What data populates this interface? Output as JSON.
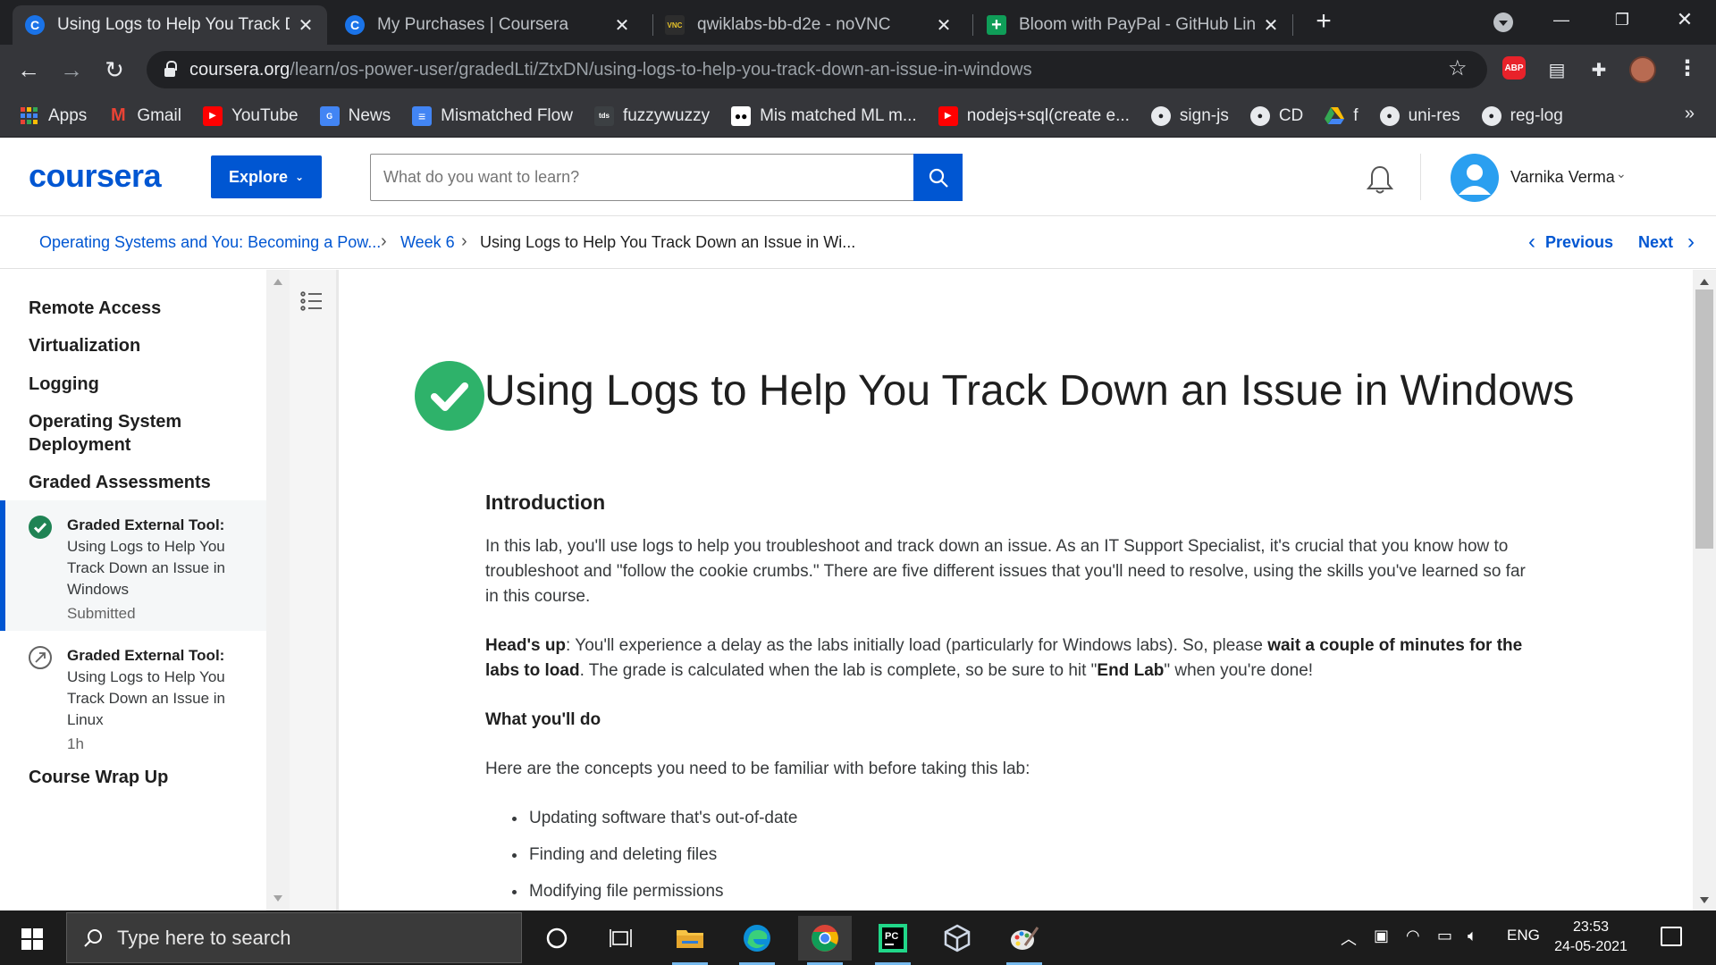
{
  "browser": {
    "tabs": [
      {
        "title": "Using Logs to Help You Track Down an Issue in Windows",
        "favicon": "C",
        "active": true
      },
      {
        "title": "My Purchases | Coursera",
        "favicon": "C",
        "active": false
      },
      {
        "title": "qwiklabs-bb-d2e - noVNC",
        "favicon": "VNC",
        "active": false
      },
      {
        "title": "Bloom with PayPal - GitHub Links",
        "favicon": "+",
        "active": false
      }
    ],
    "url_host": "coursera.org",
    "url_path": "/learn/os-power-user/gradedLti/ZtxDN/using-logs-to-help-you-track-down-an-issue-in-windows",
    "extensions": {
      "abp": "ABP"
    },
    "bookmarks": [
      {
        "label": "Apps",
        "icon": "apps-grid-icon"
      },
      {
        "label": "Gmail",
        "icon": "gmail-icon"
      },
      {
        "label": "YouTube",
        "icon": "youtube-icon"
      },
      {
        "label": "News",
        "icon": "news-icon"
      },
      {
        "label": "Mismatched Flow",
        "icon": "docs-icon"
      },
      {
        "label": "fuzzywuzzy",
        "icon": "tds-icon"
      },
      {
        "label": "Mis matched ML m...",
        "icon": "medium-icon"
      },
      {
        "label": "nodejs+sql(create e...",
        "icon": "youtube-icon"
      },
      {
        "label": "sign-js",
        "icon": "github-icon"
      },
      {
        "label": "CD",
        "icon": "github-icon"
      },
      {
        "label": "f",
        "icon": "drive-icon"
      },
      {
        "label": "uni-res",
        "icon": "github-icon"
      },
      {
        "label": "reg-log",
        "icon": "github-icon"
      }
    ],
    "bookmarks_more": "»"
  },
  "header": {
    "logo": "coursera",
    "explore_label": "Explore",
    "search_placeholder": "What do you want to learn?",
    "user_name": "Varnika Verma"
  },
  "breadcrumb": {
    "course": "Operating Systems and You: Becoming a Pow...",
    "week": "Week 6",
    "current": "Using Logs to Help You Track Down an Issue in Wi...",
    "previous_label": "Previous",
    "next_label": "Next"
  },
  "sidebar": {
    "sections": [
      "Remote Access",
      "Virtualization",
      "Logging",
      "Operating System Deployment",
      "Graded Assessments",
      "Course Wrap Up"
    ],
    "items": [
      {
        "type": "Graded External Tool:",
        "title": "Using Logs to Help You Track Down an Issue in Windows",
        "meta": "Submitted",
        "status": "completed"
      },
      {
        "type": "Graded External Tool:",
        "title": "Using Logs to Help You Track Down an Issue in Linux",
        "meta": "1h",
        "status": "not-started"
      }
    ]
  },
  "content": {
    "title": "Using Logs to Help You Track Down an Issue in Windows",
    "intro_heading": "Introduction",
    "intro_text": "In this lab, you'll use logs to help you troubleshoot and track down an issue. As an IT Support Specialist, it's crucial that you know how to troubleshoot and \"follow the cookie crumbs.\" There are five different issues that you'll need to resolve, using the skills you've learned so far in this course.",
    "headsup": {
      "label": "Head's up",
      "part1": ": You'll experience a delay as the labs initially load (particularly for Windows labs). So, please ",
      "bold1": "wait a couple of minutes for the labs to load",
      "part2": ". The grade is calculated when the lab is complete, so be sure to hit \"",
      "bold2": "End Lab",
      "part3": "\" when you're done!"
    },
    "whatyoulldo_heading": "What you'll do",
    "concepts_intro": "Here are the concepts you need to be familiar with before taking this lab:",
    "concepts": [
      "Updating software that's out-of-date",
      "Finding and deleting files",
      "Modifying file permissions"
    ]
  },
  "taskbar": {
    "search_placeholder": "Type here to search",
    "language": "ENG",
    "time": "23:53",
    "date": "24-05-2021"
  },
  "colors": {
    "brand": "#0056d2",
    "success": "#2eb26a",
    "chrome_dark": "#202124"
  }
}
